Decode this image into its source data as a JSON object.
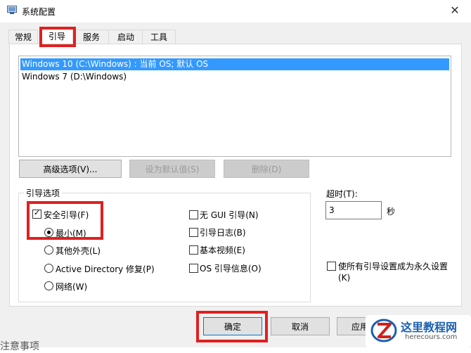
{
  "window": {
    "title": "系统配置",
    "close_glyph": "✕"
  },
  "tabs": [
    {
      "label": "常规"
    },
    {
      "label": "引导"
    },
    {
      "label": "服务"
    },
    {
      "label": "启动"
    },
    {
      "label": "工具"
    }
  ],
  "os_list": [
    {
      "label": "Windows 10 (C:\\Windows) : 当前 OS; 默认 OS",
      "selected": true
    },
    {
      "label": "Windows 7 (D:\\Windows)",
      "selected": false
    }
  ],
  "buttons": {
    "advanced": "高级选项(V)...",
    "set_default": "设为默认值(S)",
    "delete": "删除(D)"
  },
  "boot_options": {
    "title": "引导选项",
    "safe_boot": {
      "label": "安全引导(F)",
      "checked": true
    },
    "radios": [
      {
        "label": "最小(M)",
        "selected": true
      },
      {
        "label": "其他外壳(L)",
        "selected": false
      },
      {
        "label": "Active Directory 修复(P)",
        "selected": false
      },
      {
        "label": "网络(W)",
        "selected": false
      }
    ],
    "right_checks": [
      {
        "label": "无 GUI 引导(N)",
        "checked": false
      },
      {
        "label": "引导日志(B)",
        "checked": false
      },
      {
        "label": "基本视频(E)",
        "checked": false
      },
      {
        "label": "OS 引导信息(O)",
        "checked": false
      }
    ]
  },
  "timeout": {
    "label": "超时(T):",
    "value": "3",
    "unit": "秒"
  },
  "permanent": {
    "label_line1": "使所有引导设置成为永久设置",
    "label_line2": "(K)",
    "checked": false
  },
  "footer": {
    "ok": "确定",
    "cancel": "取消",
    "apply": "应用"
  },
  "bottom_fragment": "注意事项",
  "watermark": {
    "name": "这里教程网",
    "url": "herecours.com"
  },
  "colors": {
    "selection": "#3399ff",
    "highlight_box": "#e02020",
    "watermark_blue": "#1b5fb0"
  }
}
